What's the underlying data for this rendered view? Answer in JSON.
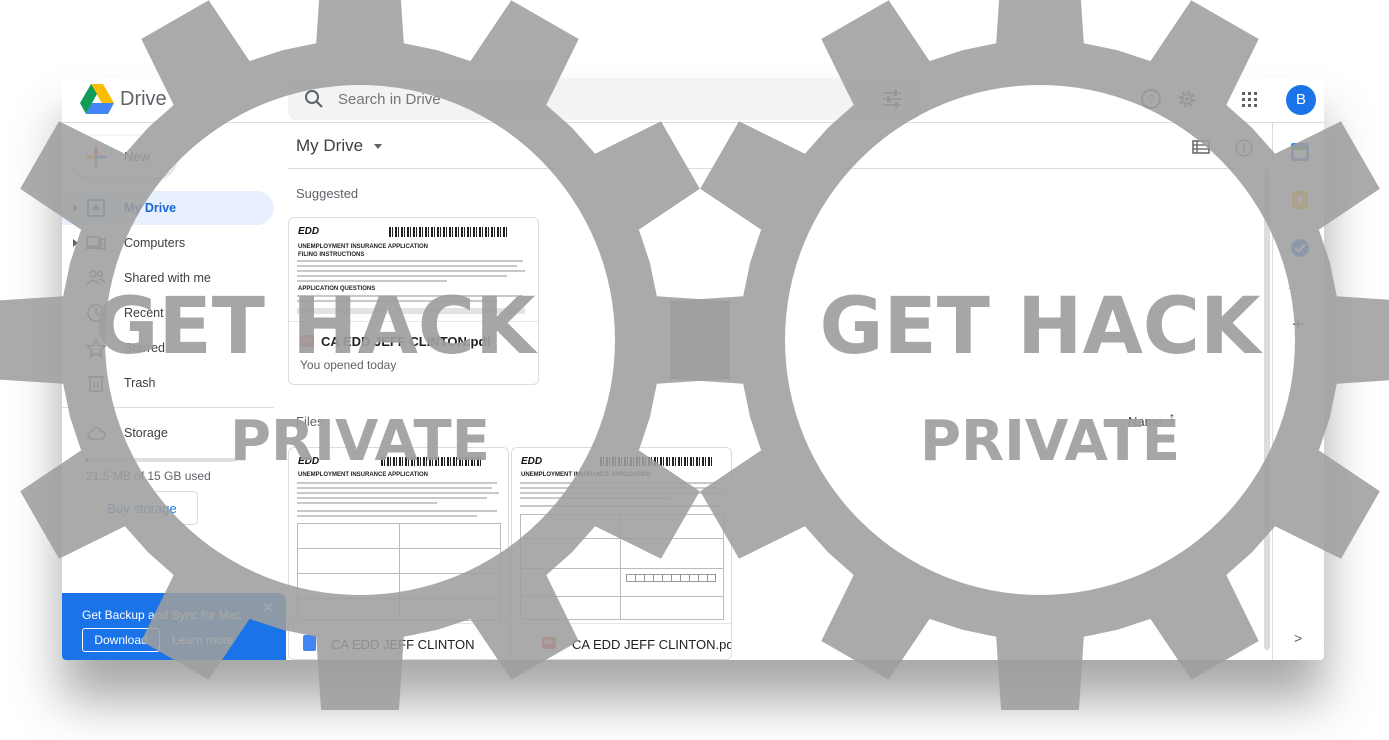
{
  "app": {
    "brand": "Drive"
  },
  "search": {
    "placeholder": "Search in Drive"
  },
  "header": {
    "avatar_letter": "B"
  },
  "sidebar": {
    "new_label": "New",
    "items": [
      {
        "label": "My Drive",
        "icon": "my-drive-icon",
        "active": true
      },
      {
        "label": "Computers",
        "icon": "computers-icon"
      },
      {
        "label": "Shared with me",
        "icon": "shared-icon"
      },
      {
        "label": "Recent",
        "icon": "clock-icon"
      },
      {
        "label": "Starred",
        "icon": "star-icon"
      },
      {
        "label": "Trash",
        "icon": "trash-icon"
      },
      {
        "label": "Storage",
        "icon": "cloud-icon"
      }
    ],
    "storage_used": 0.0014,
    "storage_text": "21.5 MB of 15 GB used",
    "buy_storage": "Buy storage"
  },
  "promo": {
    "title": "Get Backup and Sync for Mac",
    "download": "Download",
    "learn_more": "Learn more"
  },
  "main": {
    "title": "My Drive",
    "suggested_label": "Suggested",
    "files_label": "Files",
    "sort_label": "Name",
    "sort_arrow": "↑",
    "suggested": [
      {
        "name": "CA EDD JEFF CLINTON.pdf",
        "sub": "You opened today",
        "type": "pdf"
      }
    ],
    "files": [
      {
        "name": "CA EDD JEFF CLINTON",
        "type": "doc"
      },
      {
        "name": "CA EDD JEFF CLINTON.pdf",
        "type": "pdf"
      }
    ],
    "doc_preview": {
      "logo": "EDD",
      "heading": "UNEMPLOYMENT INSURANCE APPLICATION",
      "subhead1": "FILING INSTRUCTIONS",
      "subhead2": "APPLICATION QUESTIONS",
      "pdf_badge": "PDF"
    }
  },
  "watermark": {
    "line1": "GET HACK",
    "line2": "PRIVATE"
  },
  "colors": {
    "accent": "#1a73e8",
    "active_bg": "#e8f0fe",
    "pdf": "#ea4335",
    "doc": "#4285f4",
    "gear": "#9e9e9e"
  }
}
